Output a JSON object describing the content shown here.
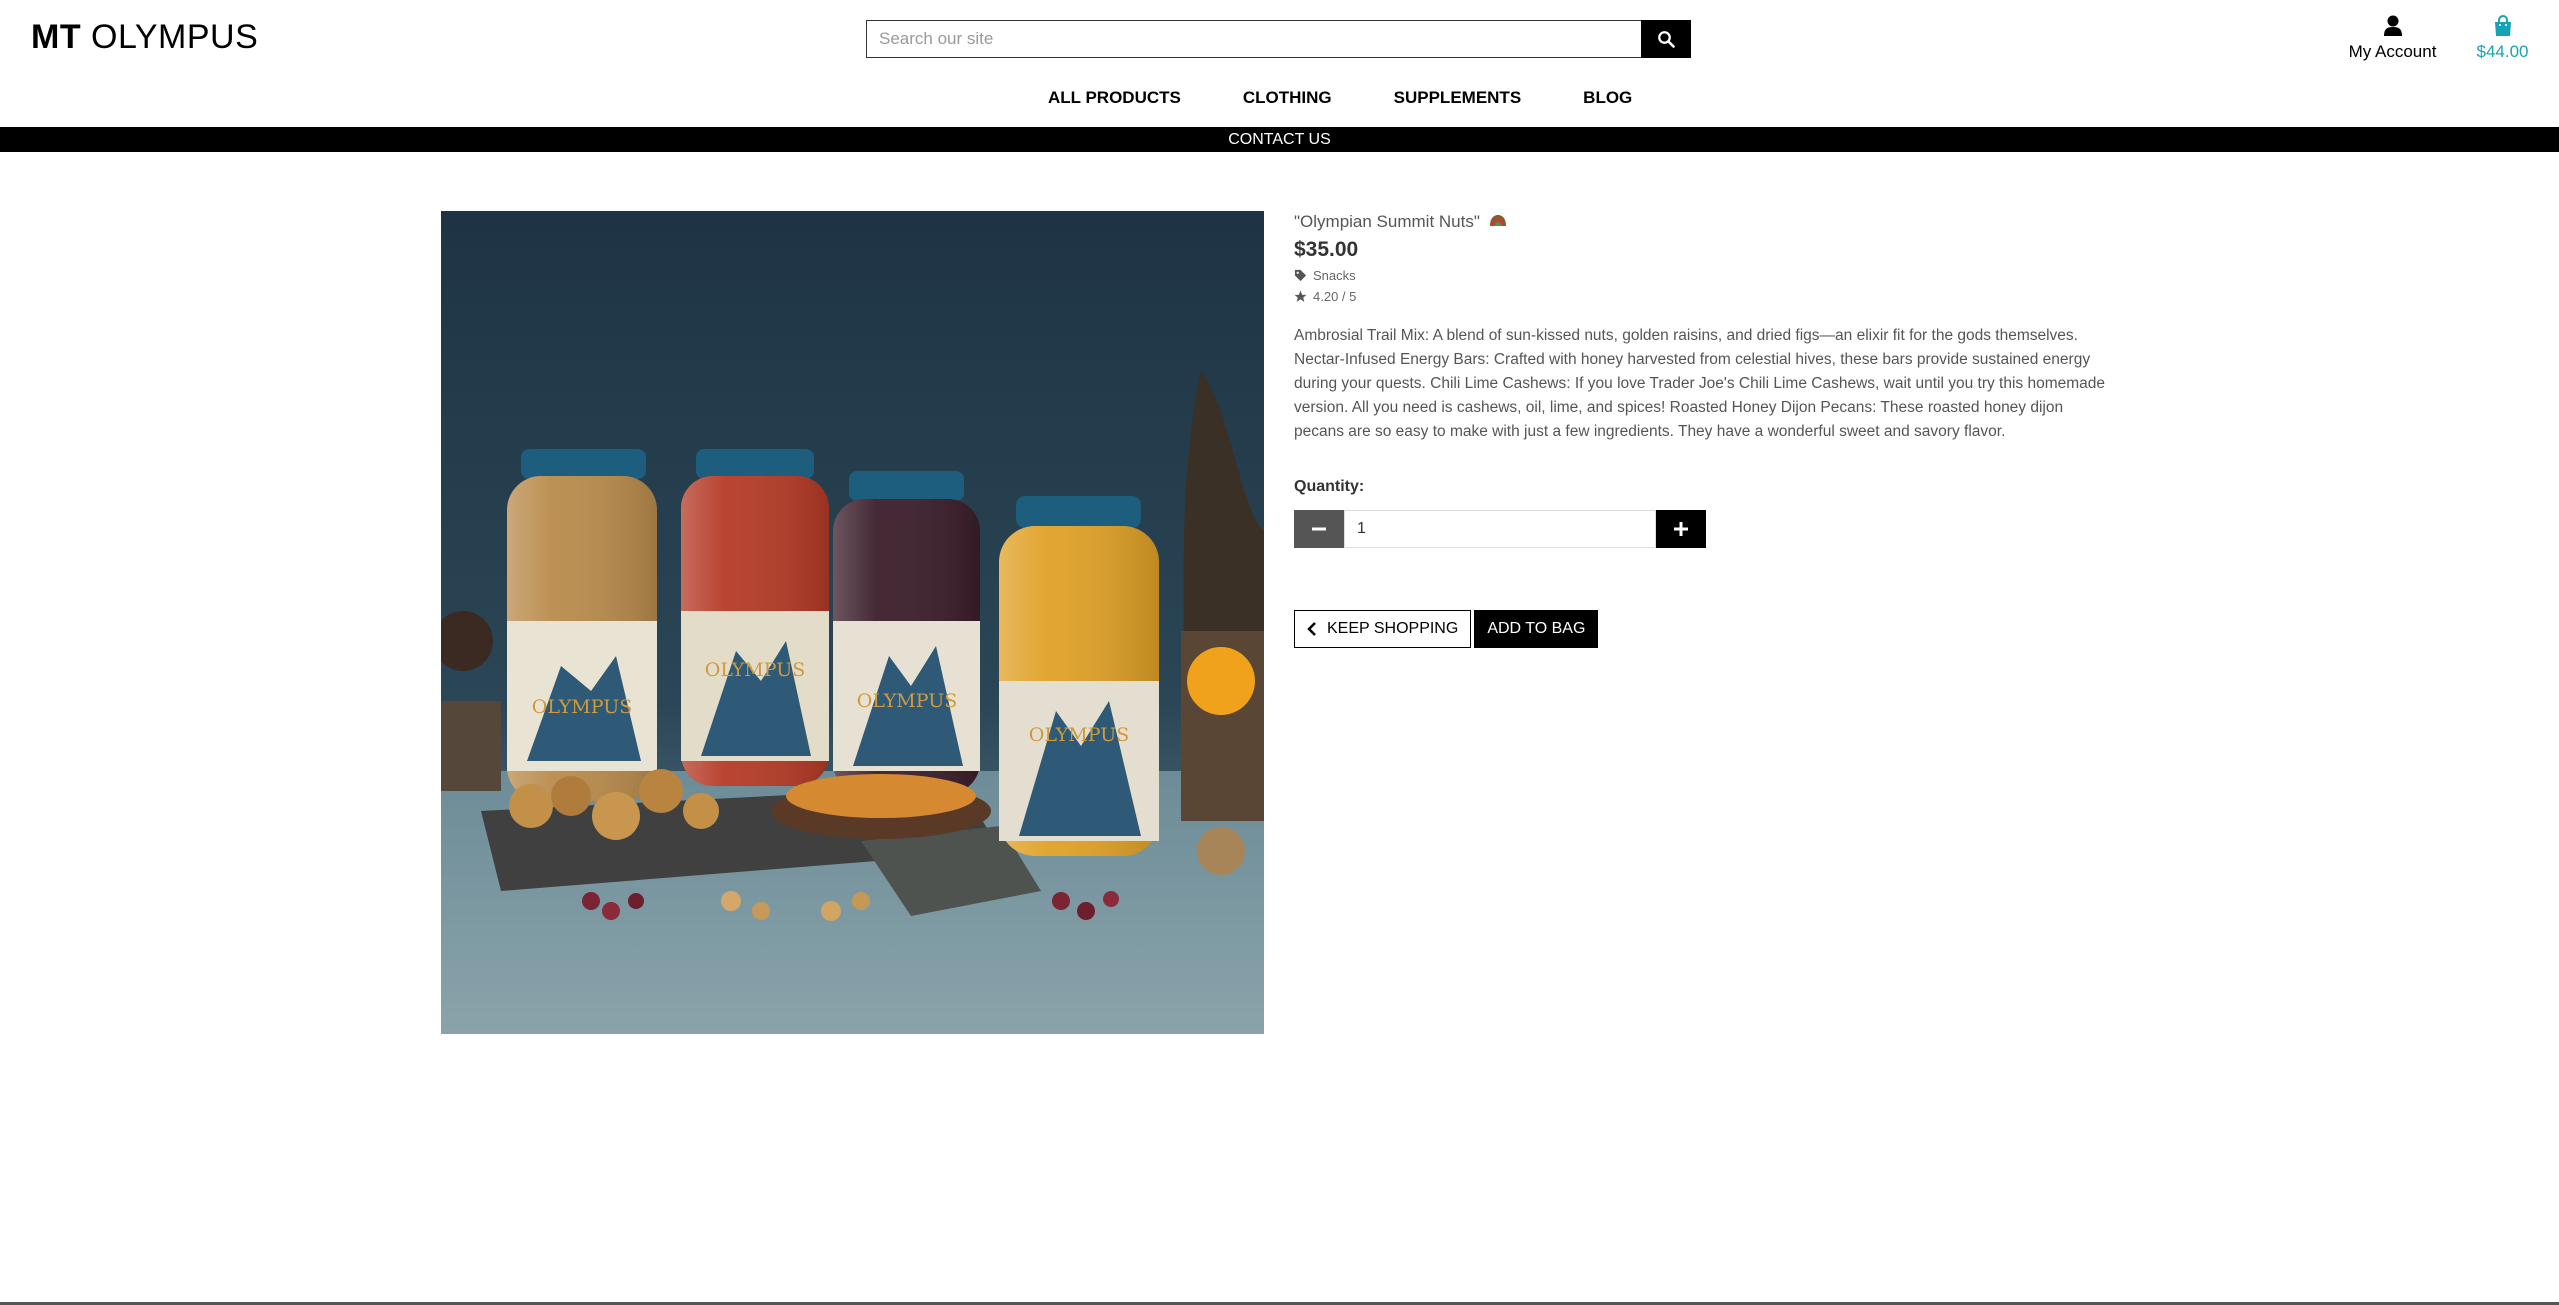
{
  "header": {
    "logo_bold": "MT",
    "logo_regular": "OLYMPUS",
    "search_placeholder": "Search our site",
    "account_label": "My Account",
    "bag_total": "$44.00"
  },
  "nav": {
    "items": [
      "ALL PRODUCTS",
      "CLOTHING",
      "SUPPLEMENTS",
      "BLOG"
    ],
    "contact_label": "CONTACT US"
  },
  "product": {
    "name": "\"Olympian Summit Nuts\"",
    "price": "$35.00",
    "category": "Snacks",
    "rating": "4.20 / 5",
    "description": "Ambrosial Trail Mix: A blend of sun-kissed nuts, golden raisins, and dried figs—an elixir fit for the gods themselves. Nectar-Infused Energy Bars: Crafted with honey harvested from celestial hives, these bars provide sustained energy during your quests. Chili Lime Cashews: If you love Trader Joe's Chili Lime Cashews, wait until you try this homemade version. All you need is cashews, oil, lime, and spices! Roasted Honey Dijon Pecans: These roasted honey dijon pecans are so easy to make with just a few ingredients. They have a wonderful sweet and savory flavor.",
    "quantity_label": "Quantity:",
    "quantity_value": "1",
    "keep_shopping_label": "KEEP SHOPPING",
    "add_to_bag_label": "ADD TO BAG",
    "jar_label_texts": [
      "OLYMPUS",
      "OLYMPUS",
      "OLYMPUS",
      "OLYMPUS"
    ]
  },
  "colors": {
    "accent": "#17a2b8",
    "dark": "#000000",
    "text_muted": "#555555"
  },
  "icons": {
    "search": "search-icon",
    "account": "user-icon",
    "bag": "shopping-bag-icon",
    "tag": "tag-icon",
    "rating": "star-icon",
    "minus": "minus-icon",
    "plus": "plus-icon",
    "back": "chevron-left-icon"
  }
}
